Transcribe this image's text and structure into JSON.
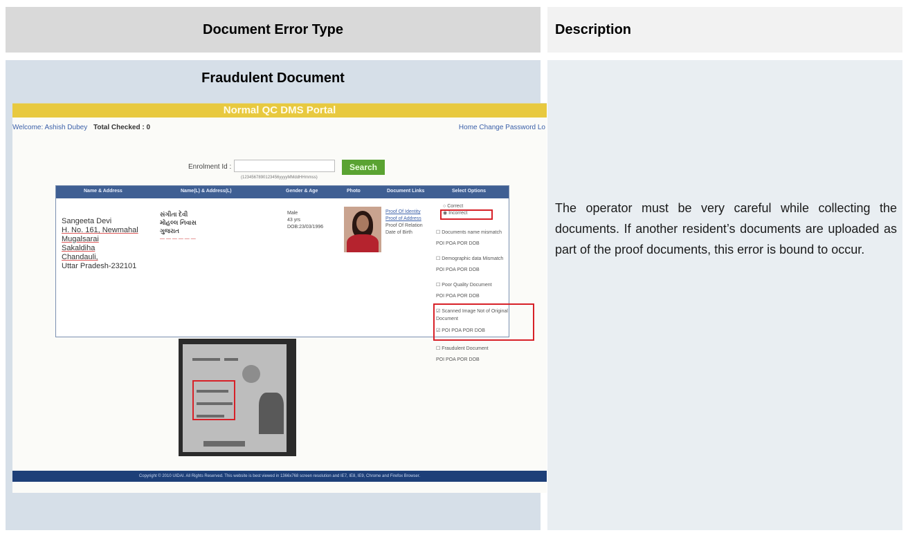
{
  "header": {
    "left_title": "Document Error Type",
    "right_title": "Description"
  },
  "row": {
    "error_type": "Fraudulent Document",
    "description": "The operator must be very careful while collecting the documents. If another resident’s documents are uploaded as part of the proof documents, this error is bound to occur."
  },
  "portal": {
    "title": "Normal QC DMS Portal",
    "welcome_label": "Welcome: Ashish Dubey",
    "total_checked": "Total Checked : 0",
    "links": "Home  Change Password  Lo",
    "enrolment_label": "Enrolment Id :",
    "enrolment_hint": "(1234567890123456yyyyMMddHHmmss)",
    "search_label": "Search",
    "columns": [
      "Name & Address",
      "Name(L) & Address(L)",
      "Gender & Age",
      "Photo",
      "Document Links",
      "Select Options"
    ],
    "record": {
      "address_lines": [
        "Sangeeta Devi",
        "H. No. 161, Newmahal",
        "Mugalsarai",
        "Sakaldiha",
        "Chandauli,",
        "Uttar Pradesh-232101"
      ],
      "local_lines": [
        "સંગીતા દેવી",
        "મોહલ્લ નિવાસ",
        "ગુજરાત"
      ],
      "gender": "Male",
      "age": "43 yrs",
      "dob": "DOB:23/03/1996",
      "doc_links": [
        "Proof Of Identity",
        "Proof of Address",
        "Proof Of Relation",
        "Date of Birth"
      ]
    },
    "options": {
      "correct": "Correct",
      "incorrect": "Incorrect",
      "doc_mismatch": "Documents name mismatch",
      "demo_mismatch": "Demographic data Mismatch",
      "poor_quality": "Poor Quality Document",
      "scanned_not_original": "Scanned Image Not of Original Document",
      "fraudulent": "Fraudulent Document",
      "sub": "POI   POA   POR   DOB"
    },
    "footer": "Copyright © 2010 UIDAI. All Rights Reserved. This website is best viewed in 1366x768 screen resolution and IE7, IE8, IE9, Chrome and Firefox Browser."
  },
  "colors": {
    "header_left_bg": "#d9d9d9",
    "header_right_bg": "#f2f2f2",
    "body_left_bg": "#d6dfe8",
    "body_right_bg": "#e9eef2",
    "portal_bar": "#e8c93f",
    "portal_table_head": "#3f5f93",
    "highlight_red": "#d72027"
  }
}
